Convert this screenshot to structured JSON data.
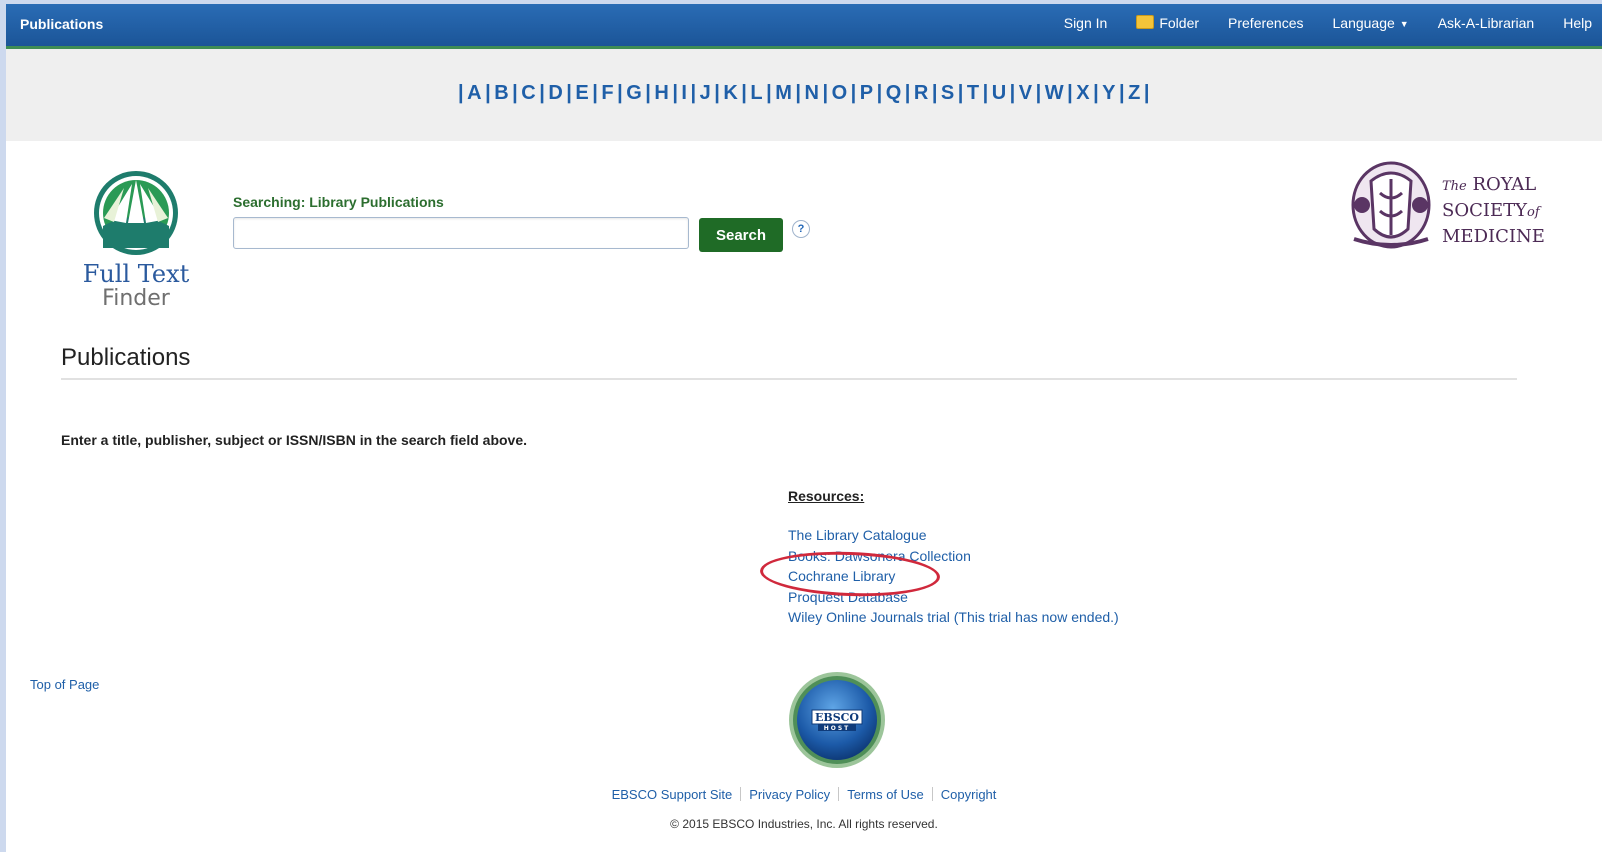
{
  "topbar": {
    "brand": "Publications",
    "nav": [
      "Sign In",
      "Folder",
      "Preferences",
      "Language",
      "Ask-A-Librarian",
      "Help"
    ]
  },
  "alphabet": [
    "A",
    "B",
    "C",
    "D",
    "E",
    "F",
    "G",
    "H",
    "I",
    "J",
    "K",
    "L",
    "M",
    "N",
    "O",
    "P",
    "Q",
    "R",
    "S",
    "T",
    "U",
    "V",
    "W",
    "X",
    "Y",
    "Z"
  ],
  "logo_left": {
    "line1": "Full Text",
    "line2": "Finder"
  },
  "search": {
    "label": "Searching: Library Publications",
    "input_value": "",
    "button": "Search",
    "help": "?"
  },
  "logo_right": {
    "the": "The",
    "royal": "ROYAL",
    "society": "SOCIETY",
    "of": "of",
    "medicine": "MEDICINE"
  },
  "page_title": "Publications",
  "instructions": "Enter a title, publisher, subject or ISSN/ISBN in the search field above.",
  "resources": {
    "heading": "Resources:",
    "items": [
      "The Library Catalogue",
      "Books: Dawsonera Collection",
      "Cochrane Library",
      "Proquest Database",
      "Wiley Online Journals trial (This trial has now ended.)"
    ]
  },
  "top_of_page": "Top of Page",
  "ebsco": {
    "line1": "EBSCO",
    "line2": "HOST"
  },
  "footer": {
    "links": [
      "EBSCO Support Site",
      "Privacy Policy",
      "Terms of Use",
      "Copyright"
    ],
    "copyright": "© 2015 EBSCO Industries, Inc. All rights reserved."
  },
  "colors": {
    "topbar": "#1b5598",
    "link": "#1f5fa8",
    "search_button": "#1f6b26",
    "annotation": "#d0293c"
  }
}
